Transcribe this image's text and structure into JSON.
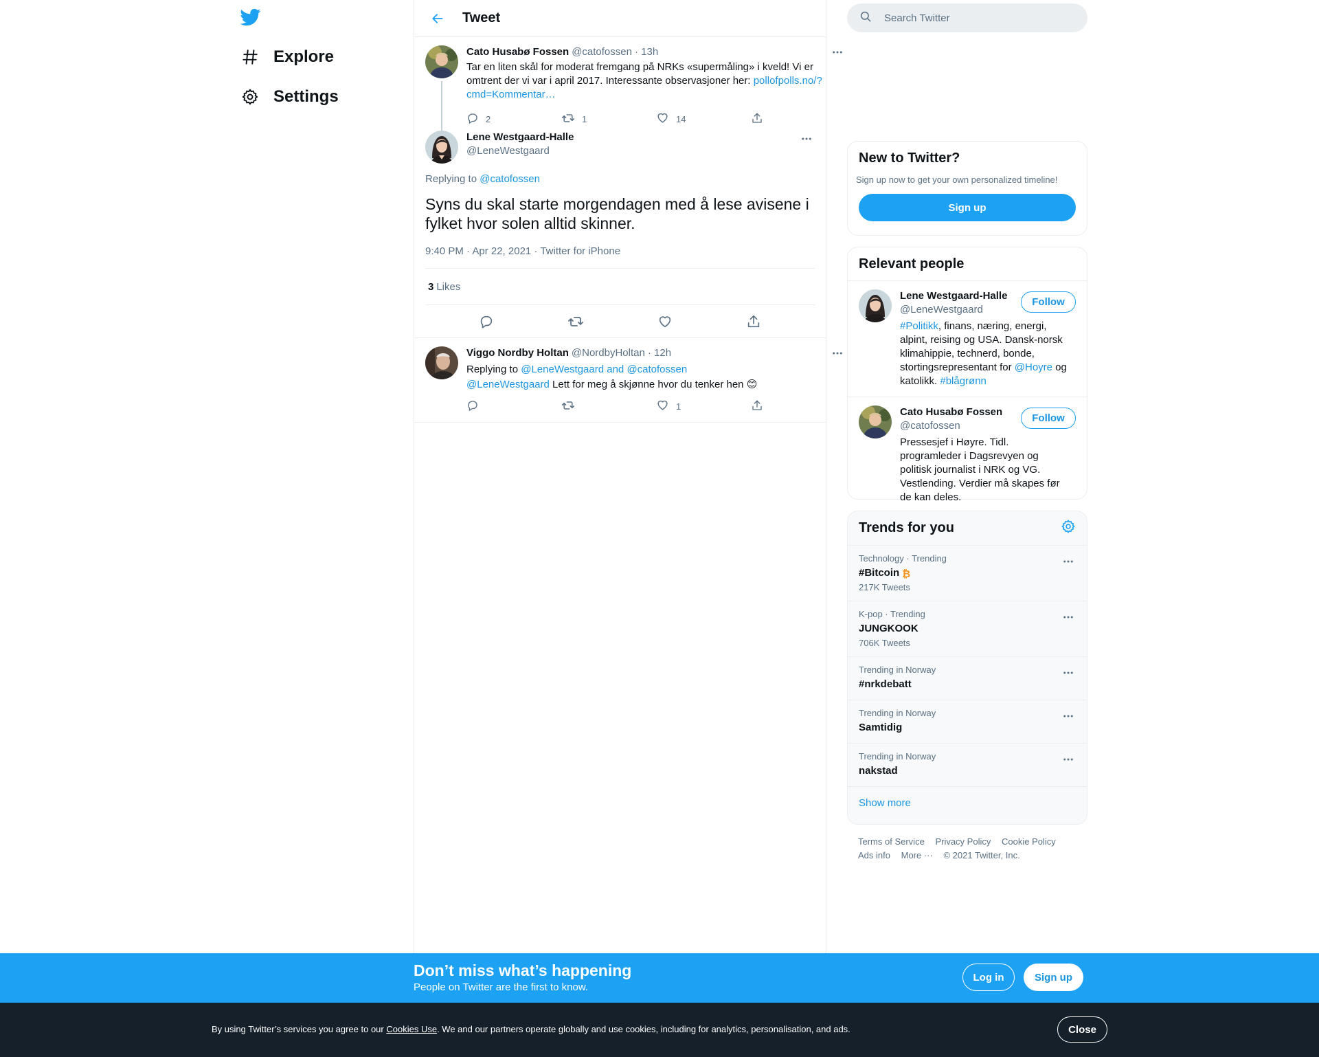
{
  "colors": {
    "accent": "#1da1f2",
    "link": "#1b95e0",
    "text": "#0f1419",
    "secondary": "#5b7083",
    "cookie_bg": "#15202b",
    "bitcoin": "#f7931a"
  },
  "nav": {
    "logo_icon": "twitter-bird-icon",
    "items": [
      {
        "label": "Explore",
        "icon": "hashtag-icon"
      },
      {
        "label": "Settings",
        "icon": "gear-icon"
      }
    ]
  },
  "header": {
    "title": "Tweet"
  },
  "parent_tweet": {
    "name": "Cato Husabø Fossen",
    "handle": "@catofossen",
    "time": "· 13h",
    "text": "Tar en liten skål for moderat fremgang på NRKs «supermåling» i kveld! Vi er omtrent der vi var i april 2017. Interessante observasjoner her:",
    "link": "pollofpolls.no/?cmd=Kommentar…",
    "replies": "2",
    "retweets": "1",
    "likes": "14"
  },
  "focus_tweet": {
    "name": "Lene Westgaard-Halle",
    "handle": "@LeneWestgaard",
    "replying_prefix": "Replying to",
    "replying_to": "@catofossen",
    "text": "Syns du skal starte morgendagen med å lese avisene i fylket hvor solen alltid skinner.",
    "meta": "9:40 PM · Apr 22, 2021 · Twitter for iPhone",
    "likes_count": "3",
    "likes_label": "Likes"
  },
  "reply_tweet": {
    "name": "Viggo Nordby Holtan",
    "handle": "@NordbyHoltan",
    "time": "· 12h",
    "replying_prefix": "Replying to",
    "replying_to": "@LeneWestgaard and @catofossen",
    "mention": "@LeneWestgaard",
    "text": "Lett for meg å skjønne hvor du tenker hen",
    "emoji": "😊",
    "likes": "1"
  },
  "search": {
    "placeholder": "Search Twitter"
  },
  "new_to_twitter": {
    "title": "New to Twitter?",
    "subtitle": "Sign up now to get your own personalized timeline!",
    "signup": "Sign up"
  },
  "relevant_people": {
    "title": "Relevant people",
    "follow": "Follow",
    "people": [
      {
        "name": "Lene Westgaard-Halle",
        "handle": "@LeneWestgaard",
        "bio_tag1": "#Politikk",
        "bio_mid": ", finans, næring, energi, alpint, reising og USA. Dansk-norsk klimahippie, technerd, bonde, stortingsrepresentant for ",
        "bio_mention": "@Hoyre",
        "bio_after": " og katolikk. ",
        "bio_tag2": "#blågrønn"
      },
      {
        "name": "Cato Husabø Fossen",
        "handle": "@catofossen",
        "bio": "Pressesjef i Høyre. Tidl. programleder i Dagsrevyen og politisk journalist i NRK og VG. Vestlending. Verdier må skapes før de kan deles."
      }
    ]
  },
  "trends": {
    "title": "Trends for you",
    "items": [
      {
        "meta": "Technology · Trending",
        "name": "#Bitcoin",
        "count": "217K Tweets"
      },
      {
        "meta": "K-pop · Trending",
        "name": "JUNGKOOK",
        "count": "706K Tweets"
      },
      {
        "meta": "Trending in Norway",
        "name": "#nrkdebatt"
      },
      {
        "meta": "Trending in Norway",
        "name": "Samtidig"
      },
      {
        "meta": "Trending in Norway",
        "name": "nakstad"
      }
    ],
    "show_more": "Show more"
  },
  "footer": {
    "links": [
      "Terms of Service",
      "Privacy Policy",
      "Cookie Policy",
      "Ads info",
      "More ···"
    ],
    "copyright": "© 2021 Twitter, Inc."
  },
  "login_bar": {
    "title": "Don’t miss what’s happening",
    "subtitle": "People on Twitter are the first to know.",
    "login": "Log in",
    "signup": "Sign up"
  },
  "cookie_bar": {
    "text_before": "By using Twitter’s services you agree to our ",
    "link": "Cookies Use",
    "text_after": ". We and our partners operate globally and use cookies, including for analytics, personalisation, and ads.",
    "close": "Close"
  }
}
